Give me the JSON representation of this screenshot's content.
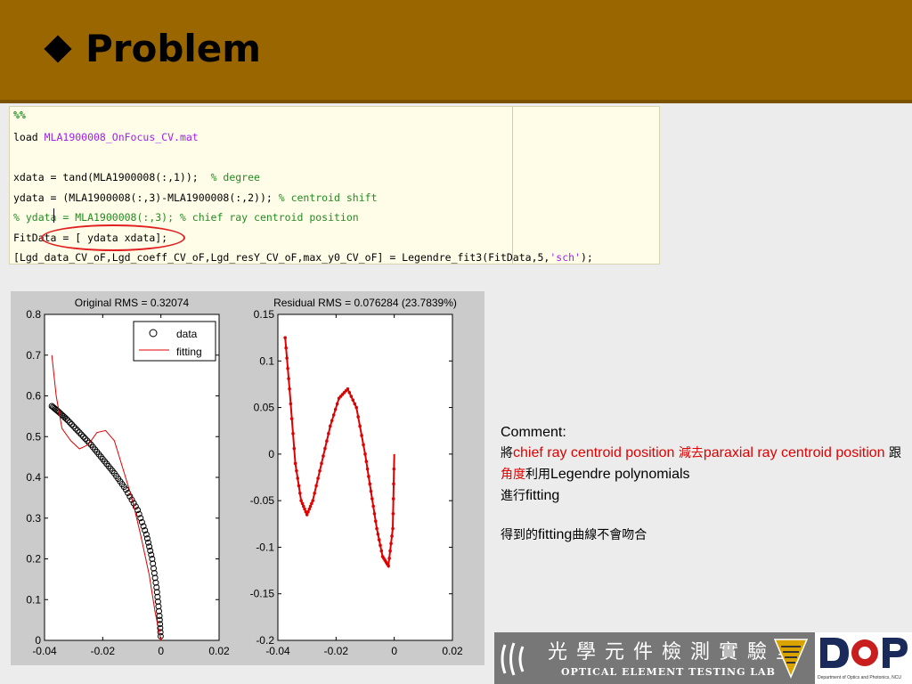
{
  "header": {
    "title": "Problem",
    "color": "#996600"
  },
  "code": {
    "lines": [
      {
        "parts": [
          {
            "t": "%%",
            "c": "cell"
          }
        ]
      },
      {
        "parts": [
          {
            "t": "load ",
            "c": "kw"
          },
          {
            "t": "MLA1900008_OnFocus_CV.mat",
            "c": "str"
          }
        ]
      },
      {
        "parts": [
          {
            "t": "",
            "c": "kw"
          }
        ]
      },
      {
        "parts": [
          {
            "t": "xdata = tand(MLA1900008(:,1));  ",
            "c": "kw"
          },
          {
            "t": "% degree",
            "c": "cmt"
          }
        ]
      },
      {
        "parts": [
          {
            "t": "ydata = (MLA1900008(:,3)-MLA1900008(:,2)); ",
            "c": "kw"
          },
          {
            "t": "% centroid shift",
            "c": "cmt"
          }
        ]
      },
      {
        "parts": [
          {
            "t": "% ydata = MLA1900008(:,3); % chief ray centroid position",
            "c": "cmt"
          }
        ]
      },
      {
        "parts": [
          {
            "t": "FitData = [ ydata xdata];",
            "c": "kw"
          }
        ]
      },
      {
        "parts": [
          {
            "t": "[Lgd_data_CV_oF,Lgd_coeff_CV_oF,Lgd_resY_CV_oF,max_y0_CV_oF] = Legendre_fit3(FitData,5,",
            "c": "kw"
          },
          {
            "t": "'sch'",
            "c": "str"
          },
          {
            "t": ");",
            "c": "kw"
          }
        ]
      }
    ]
  },
  "chart_data": [
    {
      "type": "scatter",
      "title": "Original RMS = 0.32074",
      "xlim": [
        -0.04,
        0.02
      ],
      "ylim": [
        0,
        0.8
      ],
      "xticks": [
        "-0.04",
        "-0.02",
        "0",
        "0.02"
      ],
      "yticks": [
        "0",
        "0.1",
        "0.2",
        "0.3",
        "0.4",
        "0.5",
        "0.6",
        "0.7",
        "0.8"
      ],
      "legend": {
        "position": "top-right",
        "entries": [
          "data",
          "fitting"
        ]
      },
      "series": [
        {
          "name": "data",
          "marker": "circle",
          "color": "#000000",
          "x": [
            -0.0375,
            -0.035,
            -0.032,
            -0.028,
            -0.024,
            -0.02,
            -0.016,
            -0.012,
            -0.008,
            -0.005,
            -0.003,
            -0.0015,
            -0.0005,
            0.0
          ],
          "y": [
            0.575,
            0.56,
            0.54,
            0.51,
            0.48,
            0.445,
            0.41,
            0.37,
            0.32,
            0.26,
            0.2,
            0.13,
            0.06,
            0.0
          ]
        },
        {
          "name": "fitting",
          "marker": "line",
          "color": "#e00000",
          "x": [
            -0.0375,
            -0.036,
            -0.034,
            -0.031,
            -0.028,
            -0.025,
            -0.022,
            -0.019,
            -0.016,
            -0.013,
            -0.01,
            -0.007,
            -0.004,
            -0.002,
            0.0
          ],
          "y": [
            0.7,
            0.6,
            0.52,
            0.49,
            0.47,
            0.48,
            0.51,
            0.515,
            0.49,
            0.42,
            0.35,
            0.26,
            0.16,
            0.07,
            0.0
          ]
        }
      ]
    },
    {
      "type": "line",
      "title": "Residual RMS = 0.076284 (23.7839%)",
      "xlim": [
        -0.04,
        0.02
      ],
      "ylim": [
        -0.2,
        0.15
      ],
      "xticks": [
        "-0.04",
        "-0.02",
        "0",
        "0.02"
      ],
      "yticks": [
        "-0.2",
        "-0.15",
        "-0.1",
        "-0.05",
        "0",
        "0.05",
        "0.1",
        "0.15"
      ],
      "series": [
        {
          "name": "residual",
          "marker": "dot-line",
          "color": "#e00000",
          "x": [
            -0.0375,
            -0.036,
            -0.034,
            -0.032,
            -0.03,
            -0.028,
            -0.025,
            -0.022,
            -0.019,
            -0.016,
            -0.013,
            -0.01,
            -0.008,
            -0.006,
            -0.004,
            -0.002,
            -0.0005,
            0.0
          ],
          "y": [
            0.125,
            0.07,
            -0.01,
            -0.05,
            -0.065,
            -0.05,
            -0.01,
            0.03,
            0.06,
            0.07,
            0.05,
            0.0,
            -0.04,
            -0.08,
            -0.11,
            -0.12,
            -0.08,
            0.0
          ]
        }
      ]
    }
  ],
  "comment": {
    "label": "Comment:",
    "p1a": "將",
    "p1b": "chief ray centroid position ",
    "p1c": "減去",
    "p1d": "paraxial ray centroid position ",
    "p1e": "跟",
    "p1f": "角度",
    "p1g": "利用",
    "p1h": "Legendre polynomials",
    "p1i": "進行",
    "p1j": "fitting",
    "p2a": "得到的",
    "p2b": "fitting",
    "p2c": "曲線不會吻合"
  },
  "footer": {
    "lab_zh": "光學元件檢測實驗室",
    "lab_en": "OPTICAL ELEMENT TESTING LAB",
    "logo_text": "D P",
    "dept": "Department of Optics and Photonics, NCU"
  }
}
